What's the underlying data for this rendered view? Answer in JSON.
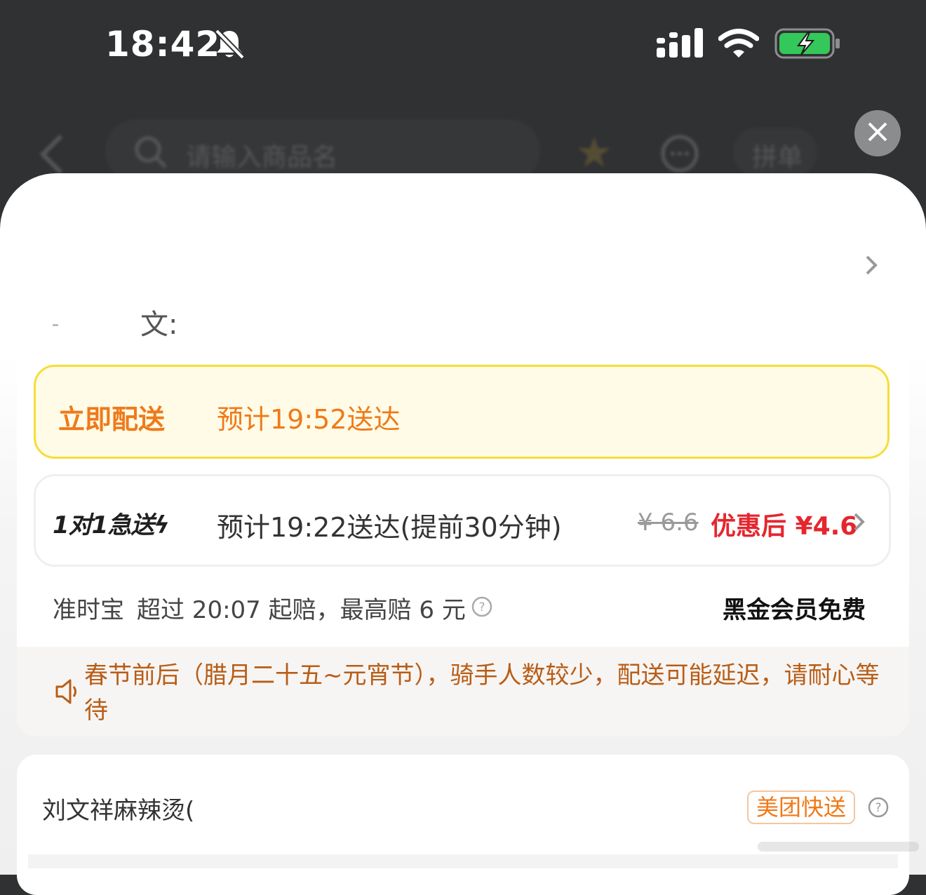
{
  "status_bar": {
    "time": "18:42"
  },
  "background_header": {
    "search_placeholder": "请输入商品名",
    "group_label": "拼单"
  },
  "address": {
    "partial_text": "文:"
  },
  "delivery_options": [
    {
      "name": "立即配送",
      "eta": "预计19:52送达",
      "selected": true
    },
    {
      "name": "1对1急送",
      "eta": "预计19:22送达(提前30分钟)",
      "original_price": "¥ 6.6",
      "discount_price": "优惠后 ¥4.6"
    }
  ],
  "guarantee": {
    "label": "准时宝",
    "text": "超过 20:07 起赔，最高赔 6 元",
    "member_text": "黑金会员免费"
  },
  "notice": {
    "text": "春节前后（腊月二十五~元宵节），骑手人数较少，配送可能延迟，请耐心等待"
  },
  "shop": {
    "name": "刘文祥麻辣烫(",
    "badge": "美团快送"
  },
  "colors": {
    "accent_orange": "#ef7a1a",
    "price_red": "#e5262e",
    "selected_border": "#f7dd3a",
    "battery_green": "#34c759"
  }
}
